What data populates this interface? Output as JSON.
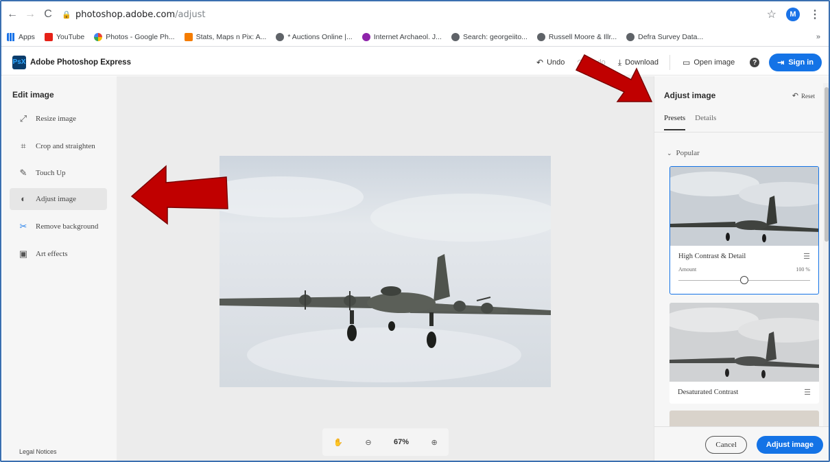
{
  "browser": {
    "url_host": "photoshop.adobe.com",
    "url_path": "/adjust",
    "profile_initial": "M",
    "bookmarks": [
      {
        "label": "Apps",
        "color": "#1a73e8"
      },
      {
        "label": "YouTube",
        "color": "#e62117"
      },
      {
        "label": "Photos - Google Ph...",
        "color": "#f4b400"
      },
      {
        "label": "Stats, Maps n Pix: A...",
        "color": "#f57c00"
      },
      {
        "label": "* Auctions Online |...",
        "color": "#5f6368"
      },
      {
        "label": "Internet Archaeol. J...",
        "color": "#8e24aa"
      },
      {
        "label": "Search: georgeiito...",
        "color": "#5f6368"
      },
      {
        "label": "Russell Moore & Illr...",
        "color": "#5f6368"
      },
      {
        "label": "Defra Survey Data...",
        "color": "#5f6368"
      }
    ]
  },
  "header": {
    "logo": "PsX",
    "title": "Adobe Photoshop Express",
    "undo": "Undo",
    "redo": "Redo",
    "download": "Download",
    "open_image": "Open image",
    "help": "?",
    "sign_in": "Sign in"
  },
  "left_panel": {
    "title": "Edit image",
    "tools": [
      {
        "label": "Resize image",
        "icon": "resize-icon"
      },
      {
        "label": "Crop and straighten",
        "icon": "crop-icon"
      },
      {
        "label": "Touch Up",
        "icon": "touch-up-icon"
      },
      {
        "label": "Adjust image",
        "icon": "adjust-icon",
        "active": true
      },
      {
        "label": "Remove background",
        "icon": "remove-background-icon"
      },
      {
        "label": "Art effects",
        "icon": "art-effects-icon"
      }
    ],
    "legal": "Legal Notices"
  },
  "canvas": {
    "zoom": "67%"
  },
  "right_panel": {
    "title": "Adjust image",
    "reset": "Reset",
    "tabs": [
      "Presets",
      "Details"
    ],
    "active_tab": "Presets",
    "section": "Popular",
    "presets": [
      {
        "label": "High Contrast & Detail",
        "selected": true,
        "amount_label": "Amount",
        "amount_value": "100 %",
        "amount_fraction": 0.5
      },
      {
        "label": "Desaturated Contrast",
        "selected": false
      }
    ],
    "cancel": "Cancel",
    "apply": "Adjust image"
  },
  "colors": {
    "accent": "#1473e6",
    "annotation_arrow": "#c00000"
  }
}
